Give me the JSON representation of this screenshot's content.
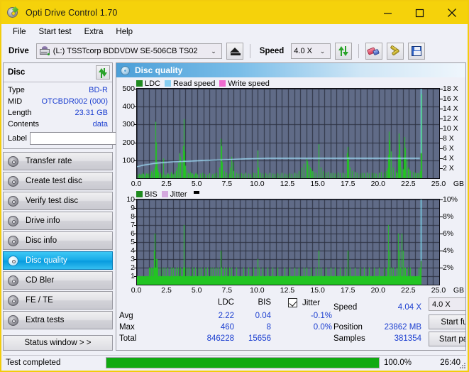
{
  "window": {
    "title": "Opti Drive Control 1.70",
    "icon": "disc-icon",
    "minimize": "–",
    "maximize": "□",
    "close": "✕",
    "accent_color": "#f5d20b"
  },
  "menu": {
    "items": [
      {
        "label": "File"
      },
      {
        "label": "Start test"
      },
      {
        "label": "Extra"
      },
      {
        "label": "Help"
      }
    ]
  },
  "toolbar": {
    "drive_label": "Drive",
    "drive_value": "(L:)  TSSTcorp BDDVDW SE-506CB TS02",
    "eject_icon": "eject-icon",
    "speed_label": "Speed",
    "speed_value": "4.0 X",
    "refresh_icon": "refresh-icon",
    "erase_icon": "eraser-icon",
    "tools_icon": "wrench-icon",
    "save_icon": "save-icon",
    "chevron": "⌄"
  },
  "sidebar": {
    "disc_panel": {
      "title": "Disc",
      "refresh_icon": "refresh-icon",
      "rows": [
        {
          "key": "Type",
          "value": "BD-R"
        },
        {
          "key": "MID",
          "value": "OTCBDR002 (000)"
        },
        {
          "key": "Length",
          "value": "23.31 GB"
        },
        {
          "key": "Contents",
          "value": "data"
        }
      ],
      "label_key": "Label",
      "label_value": "",
      "label_placeholder": "",
      "label_button_icon": "disc-icon"
    },
    "nav": [
      {
        "label": "Transfer rate",
        "icon": "disc-icon",
        "active": false
      },
      {
        "label": "Create test disc",
        "icon": "disc-icon",
        "active": false
      },
      {
        "label": "Verify test disc",
        "icon": "disc-icon",
        "active": false
      },
      {
        "label": "Drive info",
        "icon": "disc-icon",
        "active": false
      },
      {
        "label": "Disc info",
        "icon": "disc-icon",
        "active": false
      },
      {
        "label": "Disc quality",
        "icon": "disc-icon",
        "active": true
      },
      {
        "label": "CD Bler",
        "icon": "disc-icon",
        "active": false
      },
      {
        "label": "FE / TE",
        "icon": "disc-icon",
        "active": false
      },
      {
        "label": "Extra tests",
        "icon": "disc-icon",
        "active": false
      }
    ],
    "status_window_button": "Status window > >"
  },
  "main": {
    "title": "Disc quality",
    "title_icon": "disc-icon"
  },
  "stats": {
    "col_ldc": "LDC",
    "col_bis": "BIS",
    "jitter_label": "Jitter",
    "jitter_checked": true,
    "rows": [
      {
        "name": "Avg",
        "ldc": "2.22",
        "bis": "0.04",
        "jitter": "-0.1%"
      },
      {
        "name": "Max",
        "ldc": "460",
        "bis": "8",
        "jitter": "0.0%"
      },
      {
        "name": "Total",
        "ldc": "846228",
        "bis": "15656",
        "jitter": ""
      }
    ],
    "speed_label": "Speed",
    "speed_value": "4.04 X",
    "position_label": "Position",
    "position_value": "23862 MB",
    "samples_label": "Samples",
    "samples_value": "381354",
    "speed_select_value": "4.0 X",
    "start_full_button": "Start full",
    "start_part_button": "Start part",
    "chevron": "⌄"
  },
  "statusbar": {
    "text": "Test completed",
    "percent_label": "100.0%",
    "progress_percent": 100,
    "time": "26:40",
    "progress_color": "#11aa11"
  },
  "chart_data": [
    {
      "type": "line",
      "id": "ldc-chart",
      "title": "LDC",
      "xlabel": "GB",
      "ylabel": "LDC",
      "y2label": "X",
      "xlim": [
        0,
        25.0
      ],
      "ylim": [
        0,
        500
      ],
      "y2lim": [
        0,
        18
      ],
      "grid": true,
      "legend_position": "top-left",
      "legend": [
        {
          "name": "LDC",
          "color": "#1f8a1f"
        },
        {
          "name": "Read speed",
          "color": "#87cef0"
        },
        {
          "name": "Write speed",
          "color": "#f06ad0"
        }
      ],
      "xticks": [
        "0.0",
        "2.5",
        "5.0",
        "7.5",
        "10.0",
        "12.5",
        "15.0",
        "17.5",
        "20.0",
        "22.5",
        "25.0"
      ],
      "yticks": [
        100,
        200,
        300,
        400,
        500
      ],
      "y2ticks": [
        "2 X",
        "4 X",
        "6 X",
        "8 X",
        "10 X",
        "12 X",
        "14 X",
        "16 X",
        "18 X"
      ],
      "plot_bg": "#606b87",
      "series": [
        {
          "name": "LDC",
          "color": "#22c422",
          "type": "spikes",
          "x": [
            0.05,
            0.15,
            0.25,
            0.35,
            0.45,
            0.55,
            0.65,
            0.75,
            0.85,
            0.95,
            1.05,
            1.15,
            1.25,
            1.35,
            1.45,
            1.5,
            1.55,
            1.6,
            1.65,
            1.7,
            1.75,
            1.85,
            1.95,
            2.05,
            2.15,
            2.2,
            2.3,
            2.4,
            2.5,
            2.6,
            2.7,
            2.8,
            2.9,
            3.0,
            3.1,
            3.2,
            3.3,
            3.4,
            3.5,
            3.6,
            3.7,
            3.8,
            3.85,
            3.9,
            3.95,
            4.0,
            4.1,
            4.2,
            4.3,
            4.4,
            4.5,
            4.6,
            4.7,
            4.8,
            4.9,
            5.0,
            5.2,
            5.4,
            5.6,
            5.8,
            6.0,
            6.2,
            6.4,
            6.6,
            6.8,
            6.95,
            7.0,
            7.05,
            7.2,
            7.4,
            7.6,
            7.7,
            7.8,
            7.9,
            8.0,
            8.2,
            8.4,
            8.6,
            8.8,
            9.0,
            9.2,
            9.4,
            9.6,
            9.8,
            9.95,
            10.0,
            10.05,
            10.2,
            10.4,
            10.6,
            10.8,
            11.0,
            11.2,
            11.4,
            11.6,
            11.8,
            12.0,
            12.2,
            12.4,
            12.6,
            12.8,
            13.0,
            13.2,
            13.4,
            13.6,
            13.8,
            14.0,
            14.1,
            14.2,
            14.3,
            14.4,
            14.5,
            14.6,
            14.8,
            15.0,
            15.05,
            15.2,
            15.4,
            15.6,
            15.8,
            16.0,
            16.2,
            16.4,
            16.6,
            16.8,
            17.0,
            17.2,
            17.4,
            17.45,
            17.5,
            17.6,
            17.8,
            18.0,
            18.2,
            18.4,
            18.6,
            18.8,
            19.0,
            19.2,
            19.4,
            19.6,
            19.8,
            20.0,
            20.2,
            20.4,
            20.6,
            20.7,
            20.8,
            20.85,
            20.9,
            21.0,
            21.2,
            21.4,
            21.5,
            21.6,
            21.65,
            21.7,
            21.8,
            21.9,
            22.0,
            22.05,
            22.1,
            22.2,
            22.3,
            22.4,
            22.5,
            22.6,
            22.8,
            23.0,
            23.2,
            23.3,
            23.4,
            23.45,
            23.5,
            23.55
          ],
          "y": [
            20,
            25,
            18,
            22,
            30,
            24,
            19,
            28,
            22,
            26,
            20,
            40,
            30,
            45,
            60,
            120,
            315,
            200,
            90,
            50,
            35,
            25,
            30,
            20,
            25,
            110,
            22,
            18,
            30,
            24,
            20,
            35,
            26,
            22,
            30,
            40,
            60,
            85,
            140,
            120,
            90,
            180,
            330,
            290,
            150,
            70,
            45,
            30,
            25,
            35,
            28,
            24,
            20,
            26,
            30,
            22,
            25,
            30,
            24,
            20,
            28,
            22,
            26,
            30,
            60,
            220,
            180,
            90,
            40,
            30,
            25,
            60,
            120,
            90,
            40,
            30,
            25,
            28,
            24,
            30,
            26,
            22,
            30,
            28,
            155,
            120,
            60,
            30,
            25,
            28,
            22,
            30,
            26,
            24,
            28,
            22,
            30,
            26,
            22,
            28,
            24,
            30,
            26,
            40,
            60,
            80,
            110,
            95,
            75,
            60,
            50,
            40,
            35,
            30,
            190,
            150,
            60,
            40,
            30,
            35,
            28,
            30,
            26,
            32,
            28,
            30,
            26,
            140,
            175,
            120,
            60,
            40,
            35,
            30,
            25,
            30,
            28,
            32,
            26,
            30,
            28,
            25,
            30,
            35,
            30,
            40,
            55,
            130,
            260,
            210,
            150,
            60,
            40,
            30,
            130,
            250,
            190,
            120,
            60,
            50,
            120,
            230,
            170,
            110,
            60,
            50,
            40,
            35,
            30,
            28,
            30,
            40,
            120,
            420,
            470,
            300,
            80
          ]
        },
        {
          "name": "Read speed",
          "color": "#9fdcf6",
          "type": "line",
          "x": [
            0.0,
            0.5,
            1.0,
            1.5,
            2.0,
            3.0,
            4.0,
            5.0,
            6.0,
            7.0,
            8.0,
            9.0,
            10.0,
            11.0,
            12.0,
            13.0,
            14.0,
            15.0,
            16.0,
            17.0,
            18.0,
            19.0,
            20.0,
            21.0,
            22.0,
            23.0,
            23.4
          ],
          "y2": [
            2.3,
            2.6,
            2.8,
            3.0,
            3.1,
            3.3,
            3.4,
            3.5,
            3.6,
            3.7,
            3.8,
            3.9,
            3.95,
            4.0,
            4.0,
            4.0,
            4.0,
            4.0,
            4.0,
            4.0,
            4.0,
            4.0,
            4.0,
            4.0,
            4.0,
            4.0,
            4.0
          ]
        },
        {
          "name": "Write speed",
          "color": "#f06ad0",
          "type": "line",
          "x": [],
          "y2": []
        },
        {
          "name": "End marker",
          "color": "#7fe0f5",
          "type": "vertical-line",
          "x": [
            23.45
          ],
          "y2": [
            18
          ]
        }
      ]
    },
    {
      "type": "line",
      "id": "bis-chart",
      "title": "BIS",
      "xlabel": "GB",
      "ylabel": "BIS",
      "y2label": "%",
      "xlim": [
        0,
        25.0
      ],
      "ylim": [
        0,
        10
      ],
      "y2lim": [
        0,
        10
      ],
      "grid": true,
      "legend_position": "top-left",
      "legend": [
        {
          "name": "BIS",
          "color": "#1f8a1f"
        },
        {
          "name": "Jitter",
          "color": "#d4a8de"
        }
      ],
      "xticks": [
        "0.0",
        "2.5",
        "5.0",
        "7.5",
        "10.0",
        "12.5",
        "15.0",
        "17.5",
        "20.0",
        "22.5",
        "25.0"
      ],
      "yticks": [
        1,
        2,
        3,
        4,
        5,
        6,
        7,
        8,
        9,
        10
      ],
      "y2ticks": [
        "2%",
        "4%",
        "6%",
        "8%",
        "10%"
      ],
      "plot_bg": "#606b87",
      "series": [
        {
          "name": "BIS",
          "color": "#22c422",
          "type": "spikes",
          "x": [
            0.05,
            0.15,
            0.25,
            0.35,
            0.45,
            0.55,
            0.65,
            0.75,
            0.85,
            0.95,
            1.0,
            1.05,
            1.1,
            1.15,
            1.2,
            1.25,
            1.3,
            1.35,
            1.4,
            1.45,
            1.5,
            1.55,
            1.6,
            1.62,
            1.65,
            1.7,
            1.75,
            1.8,
            1.9,
            2.0,
            2.1,
            2.2,
            2.3,
            2.4,
            2.5,
            2.6,
            2.7,
            2.8,
            2.9,
            3.0,
            3.1,
            3.2,
            3.3,
            3.4,
            3.5,
            3.6,
            3.7,
            3.8,
            3.85,
            3.9,
            3.95,
            4.0,
            4.1,
            4.2,
            4.3,
            4.4,
            4.5,
            4.6,
            4.7,
            4.8,
            4.9,
            5.0,
            5.1,
            5.2,
            5.3,
            5.4,
            5.5,
            5.6,
            5.7,
            5.8,
            5.9,
            6.0,
            6.1,
            6.2,
            6.3,
            6.4,
            6.5,
            6.6,
            6.7,
            6.8,
            6.9,
            6.95,
            7.0,
            7.1,
            7.2,
            7.3,
            7.4,
            7.5,
            7.6,
            7.7,
            7.8,
            7.9,
            8.0,
            8.2,
            8.4,
            8.6,
            8.8,
            9.0,
            9.2,
            9.4,
            9.6,
            9.8,
            9.95,
            10.0,
            10.1,
            10.2,
            10.4,
            10.6,
            10.8,
            11.0,
            11.2,
            11.4,
            11.6,
            11.8,
            12.0,
            12.2,
            12.4,
            12.6,
            12.8,
            13.0,
            13.2,
            13.4,
            13.6,
            13.8,
            14.0,
            14.2,
            14.4,
            14.6,
            14.8,
            15.0,
            15.05,
            15.2,
            15.4,
            15.6,
            15.8,
            16.0,
            16.2,
            16.4,
            16.6,
            16.8,
            17.0,
            17.2,
            17.4,
            17.45,
            17.6,
            17.8,
            18.0,
            18.2,
            18.4,
            18.6,
            18.8,
            19.0,
            19.2,
            19.4,
            19.6,
            19.8,
            20.0,
            20.2,
            20.4,
            20.6,
            20.7,
            20.75,
            20.8,
            20.9,
            21.0,
            21.2,
            21.4,
            21.5,
            21.55,
            21.6,
            21.7,
            21.75,
            21.8,
            21.9,
            22.0,
            22.1,
            22.2,
            22.3,
            22.4,
            22.5,
            22.6,
            22.8,
            23.0,
            23.2,
            23.3,
            23.4,
            23.45,
            23.5
          ],
          "y": [
            1,
            1,
            1,
            1,
            1,
            1,
            1,
            1,
            1,
            1,
            2,
            2,
            1,
            2,
            1,
            2,
            1,
            2,
            4,
            6,
            2,
            2,
            3,
            3,
            2,
            2,
            1,
            1,
            2,
            1,
            2,
            1,
            2,
            1,
            2,
            1,
            1,
            2,
            1,
            2,
            1,
            2,
            1,
            2,
            1,
            2,
            1,
            2,
            7,
            5,
            2,
            1,
            2,
            1,
            2,
            1,
            1,
            2,
            1,
            2,
            1,
            1,
            2,
            1,
            2,
            1,
            1,
            2,
            1,
            2,
            1,
            1,
            2,
            1,
            2,
            1,
            2,
            1,
            2,
            1,
            2,
            4,
            2,
            1,
            2,
            1,
            2,
            1,
            2,
            1,
            2,
            1,
            1,
            2,
            1,
            1,
            2,
            1,
            2,
            1,
            2,
            1,
            3,
            2,
            2,
            1,
            2,
            1,
            2,
            1,
            2,
            1,
            2,
            1,
            1,
            2,
            1,
            2,
            1,
            2,
            1,
            2,
            1,
            2,
            2,
            1,
            2,
            1,
            2,
            4,
            3,
            2,
            1,
            2,
            1,
            2,
            1,
            2,
            1,
            2,
            1,
            2,
            1,
            4,
            2,
            1,
            2,
            1,
            2,
            1,
            2,
            1,
            2,
            1,
            2,
            1,
            2,
            1,
            2,
            1,
            2,
            2,
            7,
            4,
            2,
            2,
            1,
            2,
            1,
            6,
            4,
            2,
            2,
            6,
            4,
            2,
            2,
            1,
            2,
            1,
            2,
            1,
            1,
            1,
            2,
            2,
            8,
            8,
            2
          ]
        },
        {
          "name": "Jitter",
          "color": "#d4a8de",
          "type": "line",
          "x": [],
          "y2": []
        },
        {
          "name": "End marker",
          "color": "#7fe0f5",
          "type": "vertical-line",
          "x": [
            23.45
          ],
          "y2": [
            10
          ]
        }
      ]
    }
  ]
}
